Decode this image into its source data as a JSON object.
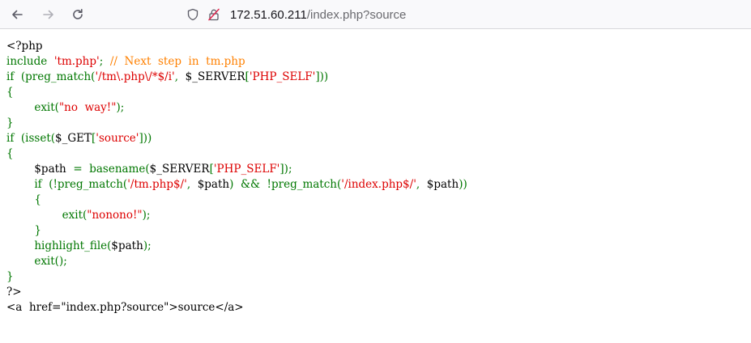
{
  "browser": {
    "back_icon": "arrow-left-icon",
    "forward_icon": "arrow-right-icon",
    "reload_icon": "reload-icon",
    "shield_icon": "shield-icon",
    "insecure_icon": "insecure-lock-icon",
    "url_host": "172.51.60.211",
    "url_path": "/index.php?source"
  },
  "colors": {
    "default": "#000000",
    "keyword": "#007700",
    "string": "#dd0000",
    "comment": "#ff8000",
    "html": "#000000"
  },
  "code_lines": [
    [
      {
        "t": "<?php",
        "c": "default"
      }
    ],
    [
      {
        "t": "include  ",
        "c": "keyword"
      },
      {
        "t": "'tm.php'",
        "c": "string"
      },
      {
        "t": ";  ",
        "c": "keyword"
      },
      {
        "t": "//  Next  step  in  tm.php",
        "c": "comment"
      }
    ],
    [
      {
        "t": "if  (preg_match(",
        "c": "keyword"
      },
      {
        "t": "'/tm\\.php\\/*$/i'",
        "c": "string"
      },
      {
        "t": ",  ",
        "c": "keyword"
      },
      {
        "t": "$_SERVER",
        "c": "default"
      },
      {
        "t": "[",
        "c": "keyword"
      },
      {
        "t": "'PHP_SELF'",
        "c": "string"
      },
      {
        "t": "]))",
        "c": "keyword"
      }
    ],
    [
      {
        "t": "{",
        "c": "keyword"
      }
    ],
    [
      {
        "t": "        exit(",
        "c": "keyword"
      },
      {
        "t": "\"no  way!\"",
        "c": "string"
      },
      {
        "t": ");",
        "c": "keyword"
      }
    ],
    [
      {
        "t": "}",
        "c": "keyword"
      }
    ],
    [
      {
        "t": "if  (isset(",
        "c": "keyword"
      },
      {
        "t": "$_GET",
        "c": "default"
      },
      {
        "t": "[",
        "c": "keyword"
      },
      {
        "t": "'source'",
        "c": "string"
      },
      {
        "t": "]))",
        "c": "keyword"
      }
    ],
    [
      {
        "t": "{",
        "c": "keyword"
      }
    ],
    [
      {
        "t": "        ",
        "c": "keyword"
      },
      {
        "t": "$path  ",
        "c": "default"
      },
      {
        "t": "=  ",
        "c": "keyword"
      },
      {
        "t": "basename(",
        "c": "keyword"
      },
      {
        "t": "$_SERVER",
        "c": "default"
      },
      {
        "t": "[",
        "c": "keyword"
      },
      {
        "t": "'PHP_SELF'",
        "c": "string"
      },
      {
        "t": "]);",
        "c": "keyword"
      }
    ],
    [
      {
        "t": "        if  (!preg_match(",
        "c": "keyword"
      },
      {
        "t": "'/tm.php$/'",
        "c": "string"
      },
      {
        "t": ",  ",
        "c": "keyword"
      },
      {
        "t": "$path",
        "c": "default"
      },
      {
        "t": ")  &&  !preg_match(",
        "c": "keyword"
      },
      {
        "t": "'/index.php$/'",
        "c": "string"
      },
      {
        "t": ",  ",
        "c": "keyword"
      },
      {
        "t": "$path",
        "c": "default"
      },
      {
        "t": "))",
        "c": "keyword"
      }
    ],
    [
      {
        "t": "        {",
        "c": "keyword"
      }
    ],
    [
      {
        "t": "                exit(",
        "c": "keyword"
      },
      {
        "t": "\"nonono!\"",
        "c": "string"
      },
      {
        "t": ");",
        "c": "keyword"
      }
    ],
    [
      {
        "t": "        }",
        "c": "keyword"
      }
    ],
    [
      {
        "t": "        highlight_file(",
        "c": "keyword"
      },
      {
        "t": "$path",
        "c": "default"
      },
      {
        "t": ");",
        "c": "keyword"
      }
    ],
    [
      {
        "t": "        exit();",
        "c": "keyword"
      }
    ],
    [
      {
        "t": "}",
        "c": "keyword"
      }
    ],
    [
      {
        "t": "?>",
        "c": "default"
      }
    ]
  ],
  "footer_html": "<a  href=\"index.php?source\">source</a>"
}
